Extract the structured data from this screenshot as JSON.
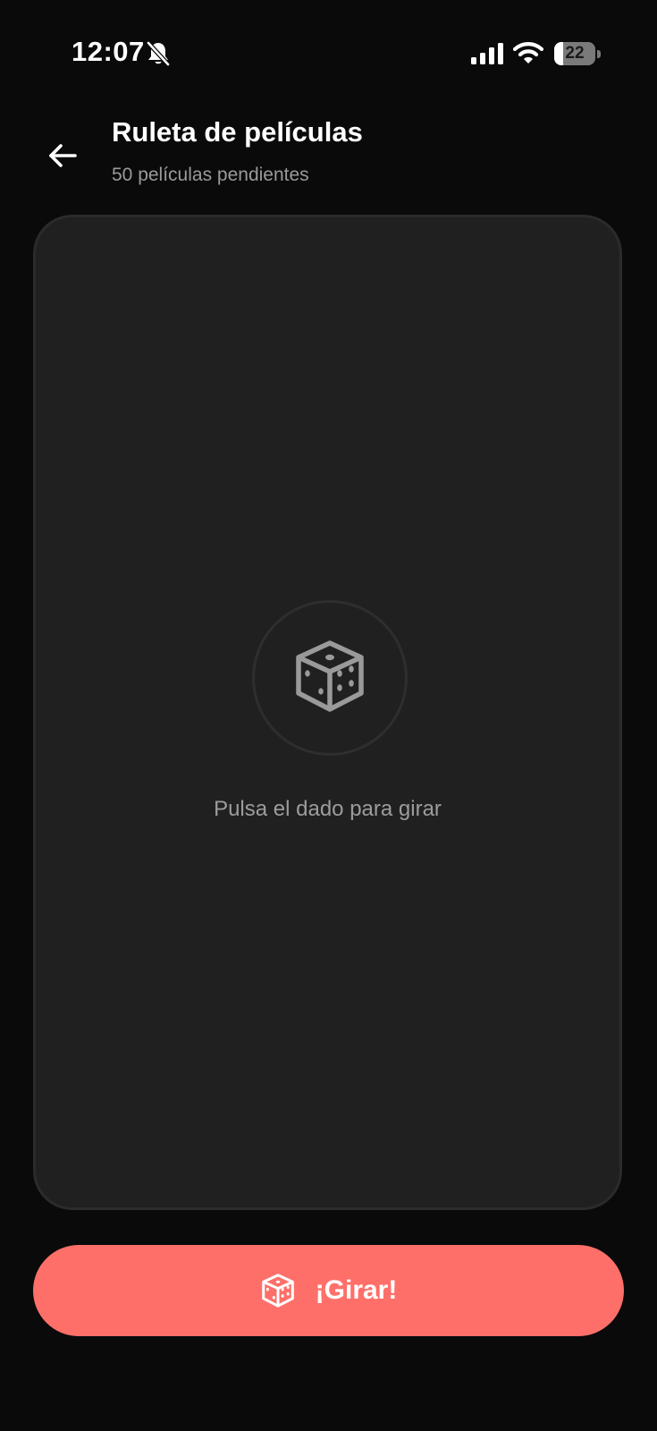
{
  "status_bar": {
    "time": "12:07",
    "battery_level": "22",
    "battery_fraction": 0.22,
    "icons": [
      "bell-off-icon",
      "signal-icon",
      "wifi-icon",
      "battery-icon"
    ]
  },
  "header": {
    "back_icon": "arrow-left-icon",
    "title": "Ruleta de películas",
    "subtitle": "50 películas pendientes"
  },
  "card": {
    "icon": "dice-icon",
    "hint": "Pulsa el dado para girar"
  },
  "spin_button": {
    "icon": "dice-icon",
    "label": "¡Girar!"
  },
  "colors": {
    "background": "#0a0a0b",
    "card": "#202020",
    "accent": "#ff6f69",
    "muted_text": "#9a9a9a"
  }
}
